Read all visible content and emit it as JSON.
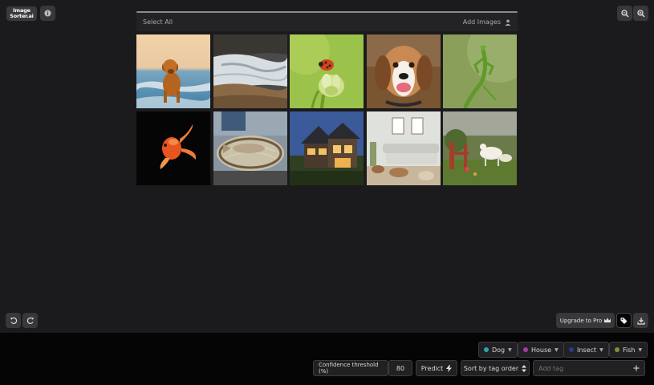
{
  "app": {
    "logo_line1": "Image",
    "logo_line2": "Sorter.ai"
  },
  "gallery": {
    "select_all_label": "Select All",
    "add_images_label": "Add Images",
    "images": [
      {
        "subject": "dog on beach"
      },
      {
        "subject": "river rapids"
      },
      {
        "subject": "ladybug on flower"
      },
      {
        "subject": "beagle"
      },
      {
        "subject": "praying mantis"
      },
      {
        "subject": "goldfish"
      },
      {
        "subject": "fish in landing net"
      },
      {
        "subject": "house at dusk"
      },
      {
        "subject": "living room"
      },
      {
        "subject": "goats in garden"
      }
    ]
  },
  "toolbar": {
    "upgrade_label": "Upgrade to Pro"
  },
  "tags": [
    {
      "label": "Dog",
      "color": "#2aa7a8"
    },
    {
      "label": "House",
      "color": "#a73aa8"
    },
    {
      "label": "Insect",
      "color": "#2b3a8a"
    },
    {
      "label": "Fish",
      "color": "#8a8a3a"
    }
  ],
  "controls": {
    "confidence_label": "Confidence threshold (%)",
    "confidence_value": "80",
    "predict_label": "Predict",
    "sort_label": "Sort by tag order",
    "add_tag_placeholder": "Add tag"
  }
}
